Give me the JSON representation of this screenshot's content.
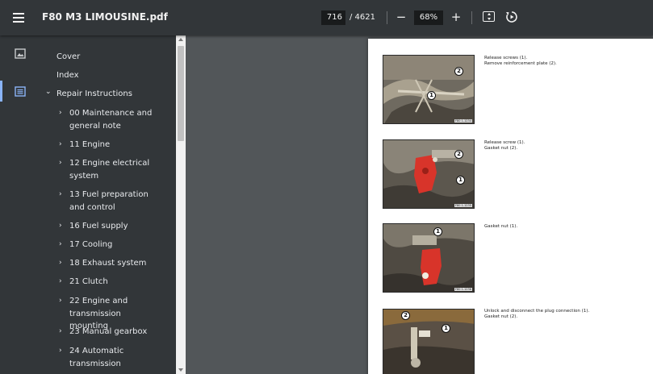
{
  "toolbar": {
    "title": "F80 M3 LIMOUSINE.pdf",
    "page_current": "716",
    "page_total": "/ 4621",
    "zoom": "68%",
    "zoom_out": "−",
    "zoom_in": "+"
  },
  "outline": {
    "items": [
      {
        "label": "Cover",
        "arrow": ""
      },
      {
        "label": "Index",
        "arrow": ""
      },
      {
        "label": "Repair Instructions",
        "arrow": "⌄"
      },
      {
        "label": "00 Maintenance and general note",
        "arrow": "›"
      },
      {
        "label": "11 Engine",
        "arrow": "›"
      },
      {
        "label": "12 Engine electrical system",
        "arrow": "›"
      },
      {
        "label": "13 Fuel preparation and control",
        "arrow": "›"
      },
      {
        "label": "16 Fuel supply",
        "arrow": "›"
      },
      {
        "label": "17 Cooling",
        "arrow": "›"
      },
      {
        "label": "18 Exhaust system",
        "arrow": "›"
      },
      {
        "label": "21 Clutch",
        "arrow": "›"
      },
      {
        "label": "22 Engine and transmission mounting",
        "arrow": "›"
      },
      {
        "label": "23 Manual gearbox",
        "arrow": "›"
      },
      {
        "label": "24 Automatic transmission",
        "arrow": "›"
      }
    ]
  },
  "document": {
    "steps": [
      {
        "lines": [
          "Release screws (1).",
          "Remove reinforcement plate (2)."
        ],
        "callouts": [
          "2",
          "1"
        ],
        "code": "F80 1-1234"
      },
      {
        "lines": [
          "Release screw (1).",
          "Gasket nut (2)."
        ],
        "callouts": [
          "2",
          "1"
        ],
        "code": "F80 1-1235"
      },
      {
        "lines": [
          "Gasket nut (1)."
        ],
        "callouts": [
          "1"
        ],
        "code": "F80 1-1236"
      },
      {
        "lines": [
          "Unlock and disconnect the plug connection (1).",
          "Gasket nut (2)."
        ],
        "callouts": [
          "2",
          "1"
        ],
        "code": ""
      }
    ]
  },
  "colors": {
    "toolbar_bg": "#323639",
    "viewer_bg": "#525659",
    "accent": "#8ab4f8",
    "mount_red": "#d8342a"
  }
}
